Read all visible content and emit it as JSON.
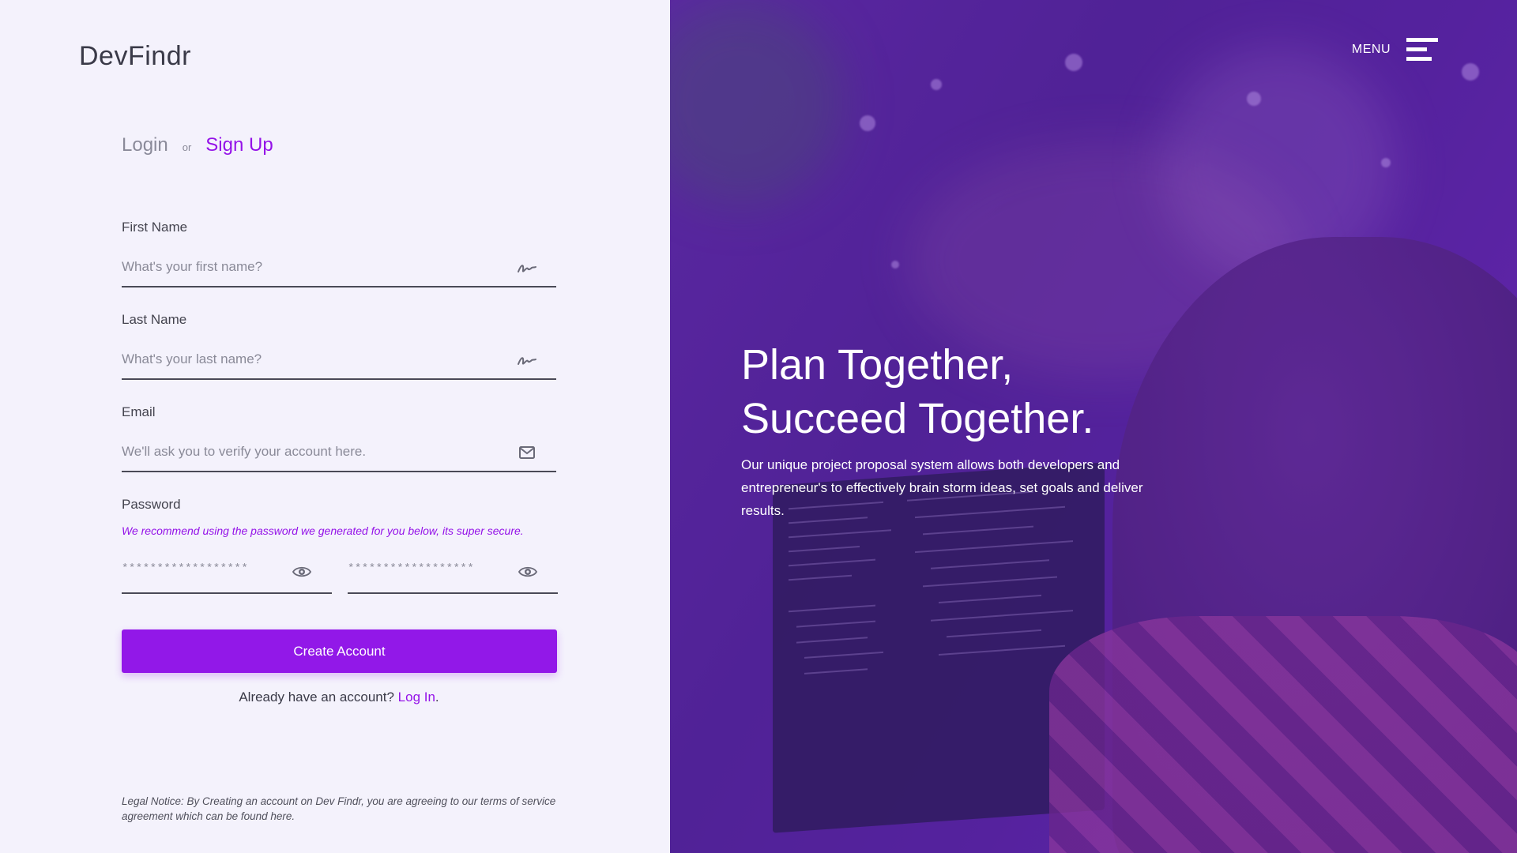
{
  "brand": "DevFindr",
  "auth_switch": {
    "login": "Login",
    "or": "or",
    "signup": "Sign Up"
  },
  "form": {
    "first_name": {
      "label": "First Name",
      "placeholder": "What's your first name?"
    },
    "last_name": {
      "label": "Last Name",
      "placeholder": "What's your last name?"
    },
    "email": {
      "label": "Email",
      "placeholder": "We'll ask you to verify your account here."
    },
    "password": {
      "label": "Password",
      "hint": "We recommend using the password we generated for you below, its super secure.",
      "value_masked": "******************",
      "confirm_masked": "******************"
    },
    "submit_label": "Create Account",
    "already": {
      "text": "Already have an account?",
      "link": "Log In",
      "after": "."
    }
  },
  "legal": "Legal Notice: By Creating an account on Dev Findr, you are agreeing to our terms of service agreement which can be found here.",
  "header": {
    "menu_label": "MENU"
  },
  "hero": {
    "title_line1": "Plan Together,",
    "title_line2": "Succeed Together.",
    "description": "Our unique project proposal system allows both developers and entrepreneur's to effectively brain storm ideas, set goals and deliver results."
  },
  "colors": {
    "accent": "#9218e8",
    "background": "#f4f2fc",
    "hero_overlay": "#5a2a9e"
  },
  "icons": {
    "name_field": "signature-icon",
    "email_field": "envelope-icon",
    "password_field": "eye-icon",
    "menu": "hamburger-icon"
  }
}
